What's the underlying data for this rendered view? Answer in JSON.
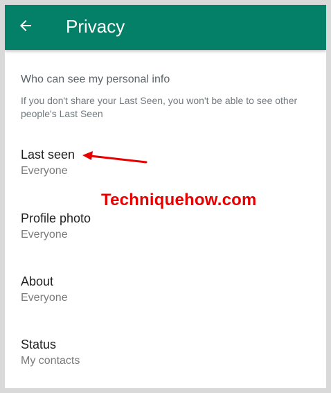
{
  "header": {
    "title": "Privacy",
    "back_icon": "arrow-left-icon"
  },
  "section": {
    "header": "Who can see my personal info",
    "description": "If you don't share your Last Seen, you won't be able to see other people's Last Seen"
  },
  "items": [
    {
      "title": "Last seen",
      "value": "Everyone"
    },
    {
      "title": "Profile photo",
      "value": "Everyone"
    },
    {
      "title": "About",
      "value": "Everyone"
    },
    {
      "title": "Status",
      "value": "My contacts"
    }
  ],
  "watermark": "Techniquehow.com",
  "colors": {
    "appbar": "#058068",
    "annotation": "#e60000"
  }
}
